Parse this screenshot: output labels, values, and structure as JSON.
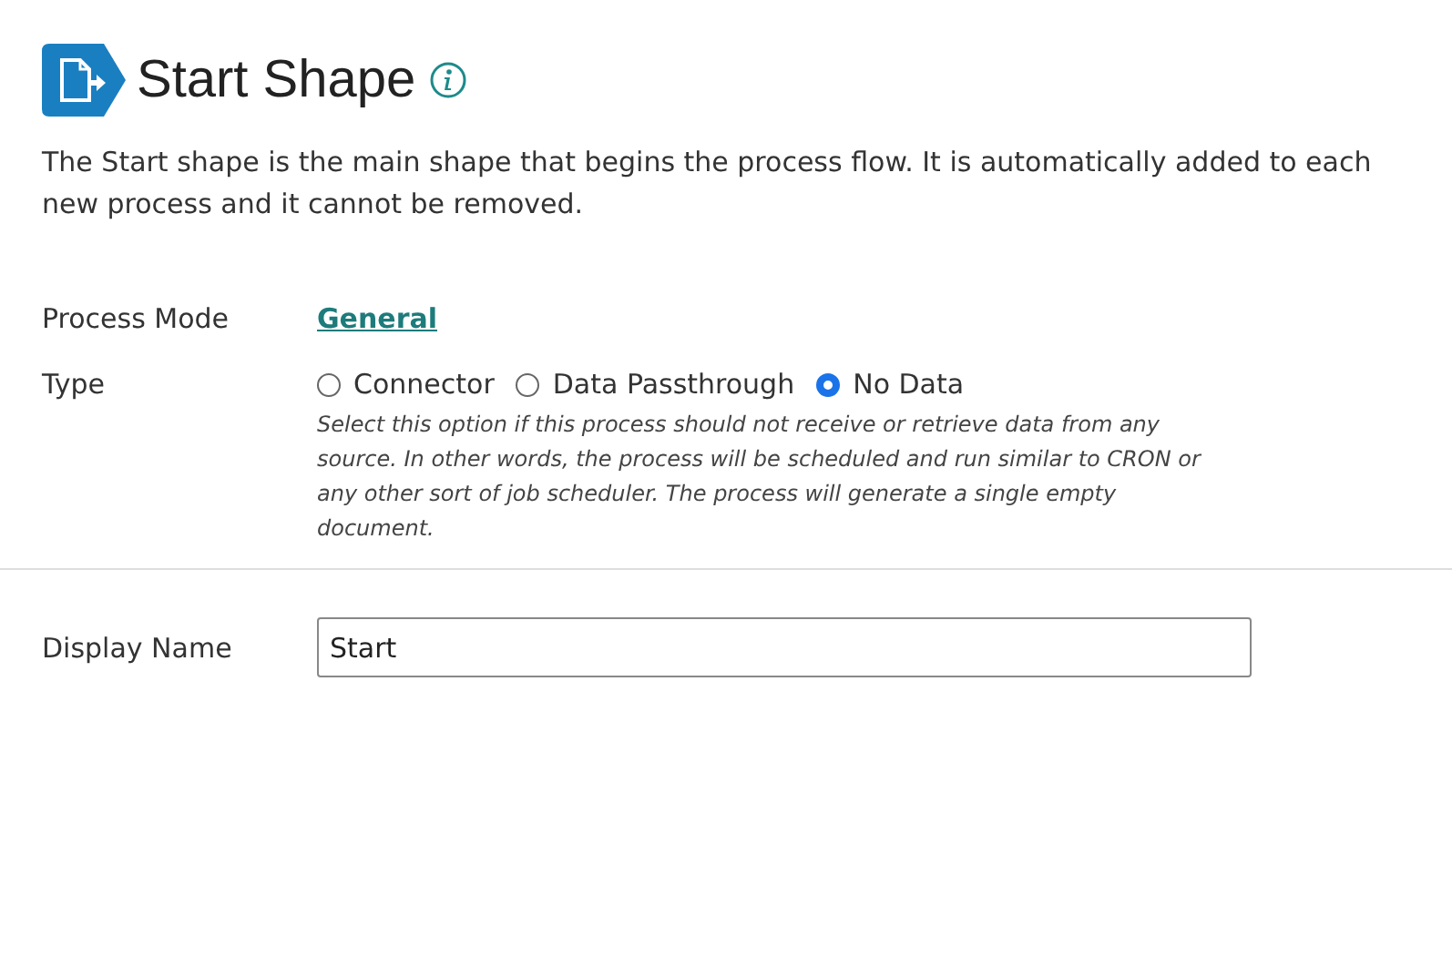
{
  "header": {
    "title": "Start Shape"
  },
  "description": "The Start shape is the main shape that begins the process flow. It is automatically added to each new process and it cannot be removed.",
  "process_mode": {
    "label": "Process Mode",
    "value": "General"
  },
  "type": {
    "label": "Type",
    "options": [
      {
        "label": "Connector",
        "selected": false
      },
      {
        "label": "Data Passthrough",
        "selected": false
      },
      {
        "label": "No Data",
        "selected": true
      }
    ],
    "help": "Select this option if this process should not receive or retrieve data from any source. In other words, the process will be scheduled and run similar to CRON or any other sort of job scheduler. The process will generate a single empty document."
  },
  "display_name": {
    "label": "Display Name",
    "value": "Start"
  }
}
